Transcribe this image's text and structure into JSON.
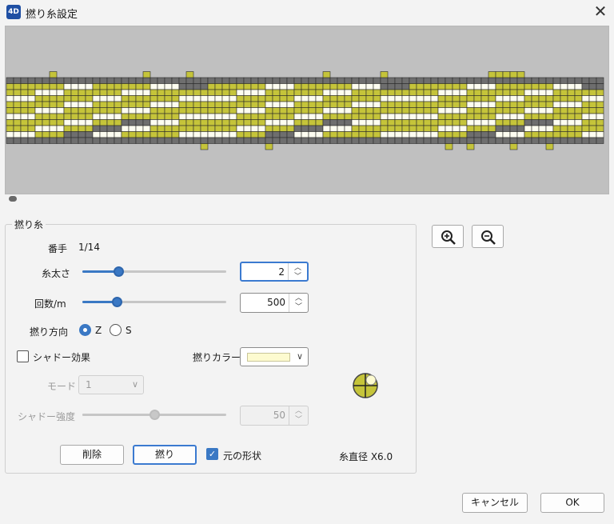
{
  "window": {
    "title": "撚り糸設定",
    "app_icon_text": "4D",
    "close_glyph": "✕"
  },
  "group": {
    "legend": "撚り糸",
    "thread_number": {
      "label": "番手",
      "value": "1/14"
    },
    "thickness": {
      "label": "糸太さ",
      "value": "2",
      "slider_fraction": 0.25
    },
    "turns": {
      "label": "回数/m",
      "value": "500",
      "slider_fraction": 0.24
    },
    "direction": {
      "label": "撚り方向",
      "options": [
        "Z",
        "S"
      ],
      "selected": "Z"
    },
    "shadow": {
      "label": "シャドー効果",
      "checked": false
    },
    "twist_color": {
      "label": "撚りカラー",
      "color": "#fdfbd0"
    },
    "mode": {
      "label": "モード",
      "value": "1"
    },
    "shadow_strength": {
      "label": "シャドー強度",
      "value": "50",
      "slider_fraction": 0.5
    },
    "delete_label": "削除",
    "twist_label": "撚り",
    "original_shape": {
      "label": "元の形状",
      "checked": true
    },
    "diameter_text": "糸直径 X6.0"
  },
  "dialog": {
    "cancel_label": "キャンセル",
    "ok_label": "OK"
  },
  "spin_arrows": "︿\n﹀",
  "combo_chevron": "∨",
  "check_glyph": "✓",
  "colors": {
    "accent": "#3a78c4",
    "thread_yellow": "#c5c43a",
    "thread_white": "#fdfdf0",
    "thread_gray": "#6e6e6e",
    "preview_bg": "#c0c0c0"
  },
  "icons": [
    "zoom-in-icon",
    "zoom-out-icon",
    "twist-preview-icon"
  ]
}
